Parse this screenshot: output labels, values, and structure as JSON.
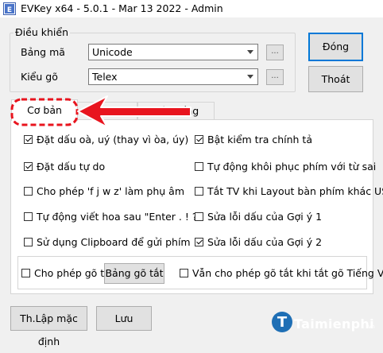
{
  "window": {
    "title": "EVKey x64 - 5.0.1 - Mar 13 2022 - Admin",
    "app_icon": "evkey-app-icon"
  },
  "control_group": {
    "title": "Điều khiển",
    "charset_label": "Bảng mã",
    "charset_value": "Unicode",
    "input_method_label": "Kiểu gõ",
    "input_method_value": "Telex",
    "ellipsis_label": "..."
  },
  "buttons": {
    "close": "Đóng",
    "exit": "Thoát",
    "defaults": "Th.Lập mặc định",
    "save": "Lưu"
  },
  "tabs": [
    {
      "label": "Cơ bản",
      "active": true
    },
    {
      "label": "...",
      "active": false
    },
    {
      "label": "Hệ thống",
      "active": false
    }
  ],
  "options_left": [
    {
      "label": "Đặt dấu oà, uý (thay vì òa, úy)",
      "checked": true
    },
    {
      "label": "Đặt dấu tự do",
      "checked": true
    },
    {
      "label": "Cho phép 'f j w z' làm phụ âm",
      "checked": false
    },
    {
      "label": "Tự động viết hoa sau \"Enter . ! ?\"",
      "checked": false
    },
    {
      "label": "Sử dụng Clipboard để gửi phím",
      "checked": false
    }
  ],
  "options_right": [
    {
      "label": "Bật kiểm tra chính tả",
      "checked": true
    },
    {
      "label": "Tự động khôi phục phím với từ sai",
      "checked": false
    },
    {
      "label": "Tắt TV khi Layout bàn phím khác US",
      "checked": false
    },
    {
      "label": "Sửa lỗi dấu của Gợi ý 1",
      "checked": false
    },
    {
      "label": "Sửa lỗi dấu của Gợi ý 2",
      "checked": true
    }
  ],
  "shortcut": {
    "enable_label": "Cho phép gõ tắt",
    "enable_checked": false,
    "table_button": "Bảng gõ tắt",
    "keep_label": "Vẫn cho phép gõ tắt khi tắt gõ Tiếng Việt",
    "keep_checked": false
  },
  "annotation": {
    "color": "#e8141e"
  },
  "watermark": {
    "text": "Taimienphi",
    "sub": ".vn",
    "color": "#1f6fb5"
  },
  "colors": {
    "accent": "#0078d7",
    "panel": "#ffffff",
    "window": "#f0f0f0"
  }
}
